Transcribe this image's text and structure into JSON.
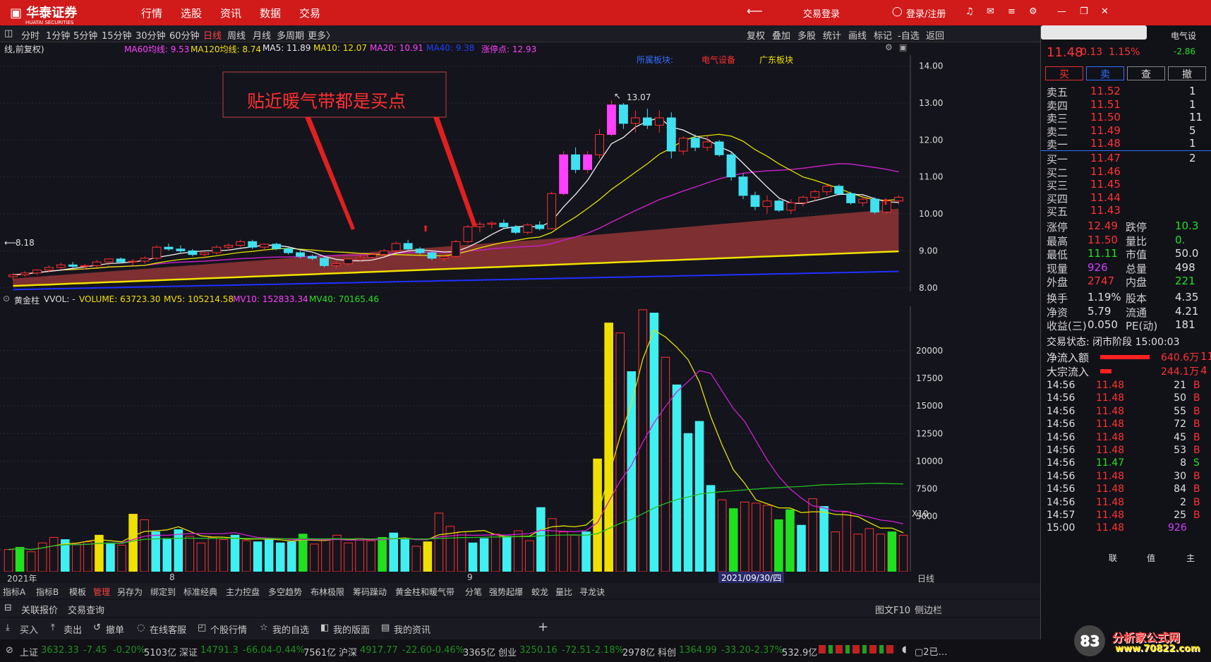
{
  "app": {
    "brand": "华泰证券",
    "brand_en": "HUATAI SECURITIES"
  },
  "nav": [
    "行情",
    "选股",
    "资讯",
    "数据",
    "交易"
  ],
  "top_right": {
    "trade_login": "交易登录",
    "login_register": "登录/注册"
  },
  "periods": [
    "分时",
    "1分钟",
    "5分钟",
    "15分钟",
    "30分钟",
    "60分钟",
    "日线",
    "周线",
    "月线",
    "多周期",
    "更多〉"
  ],
  "active_period": "日线",
  "tools": [
    "复权",
    "叠加",
    "多股",
    "统计",
    "画线",
    "标记",
    "-自选",
    "返回"
  ],
  "ma_info": {
    "mode": "线,前复权)",
    "ma60": "MA60均线: 9.53",
    "ma120": "MA120均线: 8.74",
    "ma5": "MA5: 11.89",
    "ma10": "MA10: 12.07",
    "ma20": "MA20: 10.91",
    "ma40": "MA40: 9.38",
    "limit": "涨停点: 12.93"
  },
  "boards": [
    "所属板块:",
    "电气设备",
    "广东板块"
  ],
  "annotation": "贴近暖气带都是买点",
  "price_axis": [
    "14.00",
    "13.00",
    "12.00",
    "11.00",
    "10.00",
    "9.00",
    "8.00"
  ],
  "high_label": "13.07",
  "low_label": "8.18",
  "vol_info": {
    "name": "黄金柱",
    "vvol": "VVOL: -",
    "volume": "VOLUME: 63723.30",
    "mv5": "MV5: 105214.58",
    "mv10": "MV10: 152833.34",
    "mv40": "MV40: 70165.46"
  },
  "vol_axis": [
    "20000",
    "17500",
    "15000",
    "12500",
    "10000",
    "7500",
    "5000"
  ],
  "vol_unit": "X10",
  "xaxis": {
    "year": "2021年",
    "m8": "8",
    "m9": "9",
    "date": "2021/09/30/四",
    "period": "日线"
  },
  "indicator_tabs": [
    "指标A",
    "指标B",
    "模板",
    "管理",
    "另存为",
    "绑定到",
    "标准经典",
    "主力控盘",
    "多空趋势",
    "布林极限",
    "筹码躁动",
    "黄金柱和暖气带",
    "分笔",
    "强势起爆",
    "蛟龙",
    "量比",
    "寻龙诀"
  ],
  "rel_tabs": [
    "关联报价",
    "交易查询"
  ],
  "rel_right": [
    "图文F10",
    "侧边栏"
  ],
  "actions": [
    "买入",
    "卖出",
    "撤单",
    "在线客服",
    "个股行情",
    "我的自选",
    "我的版面",
    "我的资讯"
  ],
  "quote": {
    "price": "11.48",
    "change": "0.13",
    "pct": "1.15%",
    "sector": "电气设",
    "sector_pct": "-2.86"
  },
  "trade_buttons": [
    "买",
    "卖",
    "查",
    "撤"
  ],
  "sells": [
    {
      "l": "卖五",
      "p": "11.52",
      "v": "1"
    },
    {
      "l": "卖四",
      "p": "11.51",
      "v": "1"
    },
    {
      "l": "卖三",
      "p": "11.50",
      "v": "11"
    },
    {
      "l": "卖二",
      "p": "11.49",
      "v": "5"
    },
    {
      "l": "卖一",
      "p": "11.48",
      "v": "1"
    }
  ],
  "buys": [
    {
      "l": "买一",
      "p": "11.47",
      "v": "2"
    },
    {
      "l": "买二",
      "p": "11.46",
      "v": ""
    },
    {
      "l": "买三",
      "p": "11.45",
      "v": ""
    },
    {
      "l": "买四",
      "p": "11.44",
      "v": ""
    },
    {
      "l": "买五",
      "p": "11.43",
      "v": ""
    }
  ],
  "stats": [
    {
      "a": "涨停",
      "av": "12.49",
      "ac": "up",
      "b": "跌停",
      "bv": "10.3",
      "bc": "dn"
    },
    {
      "a": "最高",
      "av": "11.50",
      "ac": "up",
      "b": "量比",
      "bv": "0.",
      "bc": "dn"
    },
    {
      "a": "最低",
      "av": "11.11",
      "ac": "dn",
      "b": "市值",
      "bv": "50.0",
      "bc": "wh"
    },
    {
      "a": "现量",
      "av": "926",
      "ac": "mg",
      "b": "总量",
      "bv": "498",
      "bc": "wh"
    },
    {
      "a": "外盘",
      "av": "2747",
      "ac": "up",
      "b": "内盘",
      "bv": "221",
      "bc": "dn"
    },
    {
      "a": "换手",
      "av": "1.19%",
      "ac": "wh",
      "b": "股本",
      "bv": "4.35",
      "bc": "wh"
    },
    {
      "a": "净资",
      "av": "5.79",
      "ac": "wh",
      "b": "流通",
      "bv": "4.21",
      "bc": "wh"
    },
    {
      "a": "收益(三)",
      "av": "0.050",
      "ac": "wh",
      "b": "PE(动)",
      "bv": "181",
      "bc": "wh"
    }
  ],
  "trade_status": "交易状态: 闭市阶段 15:00:03",
  "flows": [
    {
      "l": "净流入额",
      "v": "640.6万",
      "x": "11"
    },
    {
      "l": "大宗流入",
      "v": "244.1万",
      "x": "4"
    }
  ],
  "ticks": [
    [
      "14:56",
      "11.48",
      "21",
      "B"
    ],
    [
      "14:56",
      "11.48",
      "50",
      "B"
    ],
    [
      "14:56",
      "11.48",
      "55",
      "B"
    ],
    [
      "14:56",
      "11.48",
      "72",
      "B"
    ],
    [
      "14:56",
      "11.48",
      "45",
      "B"
    ],
    [
      "14:56",
      "11.48",
      "53",
      "B"
    ],
    [
      "14:56",
      "11.47",
      "8",
      "S"
    ],
    [
      "14:56",
      "11.48",
      "30",
      "B"
    ],
    [
      "14:56",
      "11.48",
      "84",
      "B"
    ],
    [
      "14:56",
      "11.48",
      "2",
      "B"
    ],
    [
      "14:57",
      "11.48",
      "25",
      "B"
    ],
    [
      "15:00",
      "11.48",
      "926",
      ""
    ]
  ],
  "right_bottom": [
    "联",
    "值",
    "主"
  ],
  "indices": [
    {
      "n": "上证",
      "v": "3632.33",
      "c": "-7.45",
      "p": "-0.20%",
      "a": "5103亿"
    },
    {
      "n": "深证",
      "v": "14791.3",
      "c": "-66.04",
      "p": "-0.44%",
      "a": "7561亿"
    },
    {
      "n": "沪深",
      "v": "4917.77",
      "c": "-22.60",
      "p": "-0.46%",
      "a": "3365亿"
    },
    {
      "n": "创业",
      "v": "3250.16",
      "c": "-72.51",
      "p": "-2.18%",
      "a": "2978亿"
    },
    {
      "n": "科创",
      "v": "1364.99",
      "c": "-33.20",
      "p": "-2.37%",
      "a": "532.9亿"
    }
  ],
  "watermark": {
    "line1": "分析家公式网",
    "line2": "www.70822.com"
  },
  "chart_data": [
    {
      "type": "candlestick",
      "title": "日线",
      "y_range": [
        7.9,
        14.3
      ],
      "y_ticks": [
        14,
        13,
        12,
        11,
        10,
        9,
        8
      ],
      "candles": [
        [
          8.3,
          8.4,
          8.2,
          8.35
        ],
        [
          8.35,
          8.45,
          8.3,
          8.4
        ],
        [
          8.4,
          8.5,
          8.35,
          8.48
        ],
        [
          8.48,
          8.6,
          8.42,
          8.55
        ],
        [
          8.55,
          8.68,
          8.5,
          8.62
        ],
        [
          8.62,
          8.7,
          8.55,
          8.58
        ],
        [
          8.58,
          8.65,
          8.5,
          8.6
        ],
        [
          8.6,
          8.75,
          8.55,
          8.7
        ],
        [
          8.7,
          8.8,
          8.6,
          8.78
        ],
        [
          8.78,
          8.82,
          8.66,
          8.7
        ],
        [
          8.7,
          8.78,
          8.6,
          8.72
        ],
        [
          8.72,
          8.85,
          8.65,
          8.8
        ],
        [
          8.8,
          9.15,
          8.75,
          9.1
        ],
        [
          9.1,
          9.2,
          9.0,
          9.05
        ],
        [
          9.05,
          9.15,
          8.95,
          9.0
        ],
        [
          9.0,
          9.05,
          8.85,
          8.9
        ],
        [
          8.9,
          9.0,
          8.8,
          8.95
        ],
        [
          8.95,
          9.15,
          8.9,
          9.1
        ],
        [
          9.1,
          9.2,
          9.0,
          9.15
        ],
        [
          9.15,
          9.3,
          9.1,
          9.25
        ],
        [
          9.25,
          9.3,
          9.05,
          9.1
        ],
        [
          9.1,
          9.2,
          9.0,
          9.18
        ],
        [
          9.18,
          9.22,
          9.02,
          9.06
        ],
        [
          9.06,
          9.1,
          8.9,
          8.95
        ],
        [
          8.95,
          9.0,
          8.8,
          8.85
        ],
        [
          8.85,
          8.9,
          8.75,
          8.8
        ],
        [
          8.8,
          8.85,
          8.55,
          8.6
        ],
        [
          8.6,
          8.72,
          8.52,
          8.65
        ],
        [
          8.65,
          8.8,
          8.6,
          8.78
        ],
        [
          8.78,
          8.9,
          8.72,
          8.82
        ],
        [
          8.82,
          8.95,
          8.75,
          8.9
        ],
        [
          8.9,
          9.05,
          8.85,
          9.0
        ],
        [
          9.0,
          9.25,
          8.95,
          9.2
        ],
        [
          9.2,
          9.3,
          9.0,
          9.05
        ],
        [
          9.05,
          9.1,
          8.9,
          8.95
        ],
        [
          8.95,
          9.0,
          8.75,
          8.8
        ],
        [
          8.8,
          8.9,
          8.72,
          8.85
        ],
        [
          8.85,
          9.3,
          8.8,
          9.25
        ],
        [
          9.25,
          9.7,
          9.2,
          9.65
        ],
        [
          9.65,
          9.8,
          9.5,
          9.72
        ],
        [
          9.72,
          9.8,
          9.6,
          9.75
        ],
        [
          9.75,
          9.85,
          9.6,
          9.65
        ],
        [
          9.65,
          9.7,
          9.45,
          9.5
        ],
        [
          9.5,
          9.75,
          9.45,
          9.7
        ],
        [
          9.7,
          9.8,
          9.55,
          9.6
        ],
        [
          9.6,
          10.6,
          9.58,
          10.55
        ],
        [
          10.55,
          11.7,
          10.5,
          11.6
        ],
        [
          11.6,
          11.8,
          11.1,
          11.2
        ],
        [
          11.2,
          11.7,
          11.1,
          11.6
        ],
        [
          11.6,
          12.3,
          11.5,
          12.15
        ],
        [
          12.15,
          13.07,
          12.1,
          12.95
        ],
        [
          12.95,
          13.0,
          12.3,
          12.45
        ],
        [
          12.45,
          12.8,
          12.2,
          12.6
        ],
        [
          12.6,
          12.85,
          12.3,
          12.4
        ],
        [
          12.4,
          12.8,
          12.2,
          12.6
        ],
        [
          12.6,
          12.75,
          11.5,
          11.7
        ],
        [
          11.7,
          12.1,
          11.6,
          12.05
        ],
        [
          12.05,
          12.15,
          11.7,
          11.8
        ],
        [
          11.8,
          12.1,
          11.7,
          11.95
        ],
        [
          11.95,
          12.0,
          11.55,
          11.6
        ],
        [
          11.6,
          11.7,
          10.9,
          11.0
        ],
        [
          11.0,
          11.1,
          10.4,
          10.5
        ],
        [
          10.5,
          10.6,
          10.1,
          10.2
        ],
        [
          10.2,
          10.5,
          10.0,
          10.35
        ],
        [
          10.35,
          10.4,
          10.05,
          10.1
        ],
        [
          10.1,
          10.4,
          10.0,
          10.3
        ],
        [
          10.3,
          10.5,
          10.2,
          10.45
        ],
        [
          10.45,
          10.65,
          10.35,
          10.6
        ],
        [
          10.6,
          10.8,
          10.5,
          10.75
        ],
        [
          10.75,
          10.8,
          10.5,
          10.55
        ],
        [
          10.55,
          10.6,
          10.25,
          10.3
        ],
        [
          10.3,
          10.5,
          10.2,
          10.4
        ],
        [
          10.4,
          10.45,
          10.0,
          10.05
        ],
        [
          10.05,
          10.4,
          10.0,
          10.35
        ],
        [
          10.35,
          10.5,
          10.25,
          10.45
        ]
      ]
    },
    {
      "type": "bar",
      "title": "黄金柱",
      "y_range": [
        0,
        23500
      ],
      "y_ticks": [
        20000,
        17500,
        15000,
        12500,
        10000,
        7500,
        5000
      ],
      "volumes": [
        2000,
        2200,
        1800,
        2600,
        3100,
        2900,
        2500,
        2700,
        3300,
        2600,
        2400,
        5200,
        4700,
        3600,
        3000,
        3800,
        3200,
        2600,
        3100,
        2900,
        3300,
        2800,
        2700,
        3000,
        2600,
        2700,
        3400,
        2500,
        2900,
        3300,
        2600,
        3000,
        2800,
        3100,
        3500,
        2900,
        2300,
        2700,
        5300,
        4100,
        3600,
        2600,
        3000,
        3400,
        3200,
        3700,
        2800,
        5800,
        4800,
        3600,
        3300,
        3600,
        10200,
        22500,
        21600,
        18100,
        23700,
        23400,
        19400,
        16900,
        12500,
        13600,
        7800,
        6500,
        5700,
        6300,
        6200,
        6000,
        4700,
        5600,
        4200,
        6600,
        5900,
        3600,
        5400,
        3400,
        3900,
        3400,
        3600,
        3300
      ],
      "colors": "mixed"
    }
  ]
}
